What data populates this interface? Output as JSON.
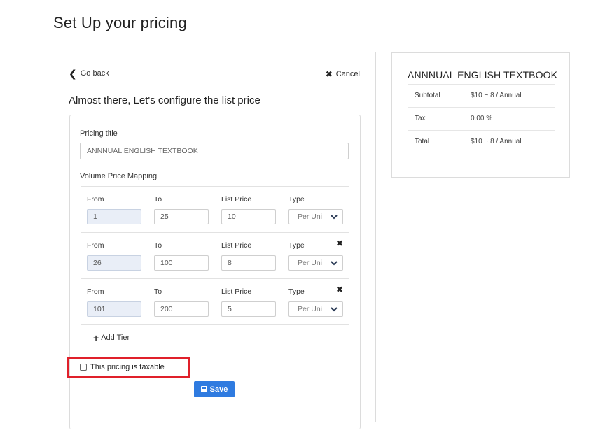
{
  "page": {
    "title": "Set Up your pricing"
  },
  "topbar": {
    "go_back": "Go back",
    "cancel": "Cancel"
  },
  "form": {
    "subtitle": "Almost there, Let's configure the list price",
    "pricing_title_label": "Pricing title",
    "pricing_title_value": "ANNNUAL ENGLISH TEXTBOOK",
    "volume_label": "Volume Price Mapping",
    "columns": {
      "from": "From",
      "to": "To",
      "list_price": "List Price",
      "type": "Type"
    },
    "tiers": [
      {
        "from": "1",
        "to": "25",
        "list_price": "10",
        "type": "Per Uni"
      },
      {
        "from": "26",
        "to": "100",
        "list_price": "8",
        "type": "Per Uni"
      },
      {
        "from": "101",
        "to": "200",
        "list_price": "5",
        "type": "Per Uni"
      }
    ],
    "add_tier": "Add Tier",
    "taxable_label": "This pricing is taxable",
    "taxable_checked": false,
    "save_label": "Save"
  },
  "summary": {
    "title": "ANNNUAL ENGLISH TEXTBOOK",
    "rows": [
      {
        "label": "Subtotal",
        "value": "$10 ~ 8 / Annual"
      },
      {
        "label": "Tax",
        "value": "0.00 %"
      },
      {
        "label": "Total",
        "value": "$10 ~ 8 / Annual"
      }
    ]
  },
  "colors": {
    "accent": "#2f7be0",
    "highlight_border": "#e0202a",
    "readonly_bg": "#e9eef7"
  }
}
